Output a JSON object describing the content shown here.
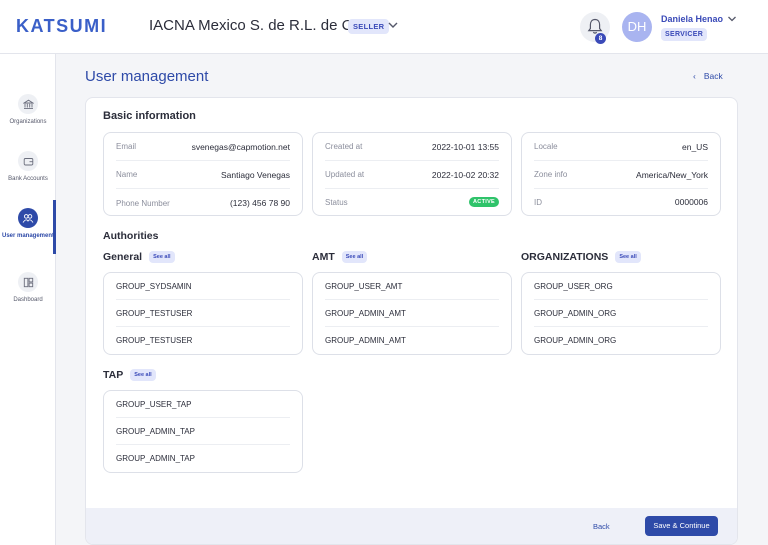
{
  "header": {
    "logo": "KATSUMI",
    "company": "IACNA Mexico S. de R.L. de C.V.",
    "company_badge": "SELLER",
    "notification_count": "8",
    "avatar_initials": "DH",
    "user_name": "Daniela Henao",
    "user_role": "SERVICER"
  },
  "sidebar": {
    "items": [
      {
        "label": "Organizations",
        "icon": "bank-icon"
      },
      {
        "label": "Bank Accounts",
        "icon": "wallet-icon"
      },
      {
        "label": "User management",
        "icon": "users-icon",
        "active": true
      },
      {
        "label": "Dashboard",
        "icon": "dashboard-icon"
      }
    ]
  },
  "page": {
    "title": "User management",
    "back_label": "Back"
  },
  "basic_info": {
    "title": "Basic information",
    "box1": [
      {
        "label": "Email",
        "value": "svenegas@capmotion.net"
      },
      {
        "label": "Name",
        "value": "Santiago Venegas"
      },
      {
        "label": "Phone Number",
        "value": "(123) 456 78 90"
      }
    ],
    "box2": [
      {
        "label": "Created at",
        "value": "2022-10-01 13:55"
      },
      {
        "label": "Updated at",
        "value": "2022-10-02 20:32"
      },
      {
        "label": "Status",
        "value": "ACTIVE"
      }
    ],
    "box3": [
      {
        "label": "Locale",
        "value": "en_US"
      },
      {
        "label": "Zone info",
        "value": "America/New_York"
      },
      {
        "label": "ID",
        "value": "0000006"
      }
    ]
  },
  "authorities": {
    "title": "Authorities",
    "see_all_label": "See all",
    "groups": [
      {
        "name": "General",
        "items": [
          "GROUP_SYDSAMIN",
          "GROUP_TESTUSER",
          "GROUP_TESTUSER"
        ]
      },
      {
        "name": "AMT",
        "items": [
          "GROUP_USER_AMT",
          "GROUP_ADMIN_AMT",
          "GROUP_ADMIN_AMT"
        ]
      },
      {
        "name": "ORGANIZATIONS",
        "items": [
          "GROUP_USER_ORG",
          "GROUP_ADMIN_ORG",
          "GROUP_ADMIN_ORG"
        ]
      },
      {
        "name": "TAP",
        "items": [
          "GROUP_USER_TAP",
          "GROUP_ADMIN_TAP",
          "GROUP_ADMIN_TAP"
        ]
      }
    ]
  },
  "footer": {
    "back_label": "Back",
    "save_label": "Save & Continue"
  },
  "colors": {
    "primary": "#2e4aa8",
    "logo": "#3a5fc8",
    "status_active": "#2fc36a",
    "badge_bg": "#e2e6fb"
  }
}
